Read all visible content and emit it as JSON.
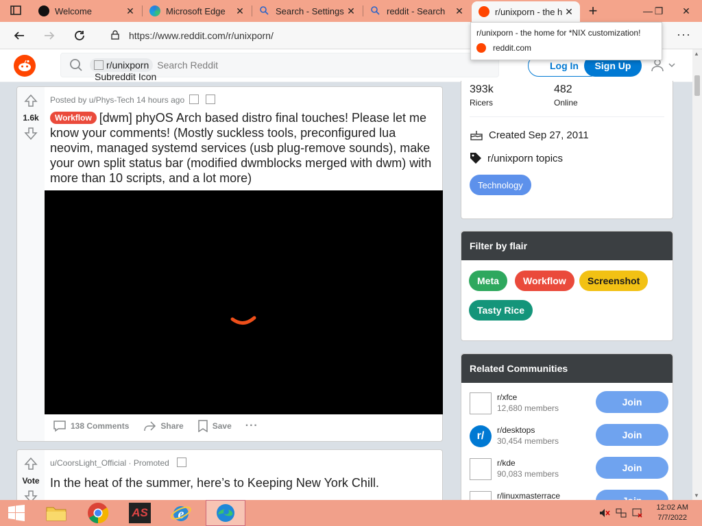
{
  "browser": {
    "tabs": [
      {
        "title": "Welcome",
        "close": "✕"
      },
      {
        "title": "Microsoft Edge",
        "close": "✕"
      },
      {
        "title": "Search - Settings",
        "close": "✕"
      },
      {
        "title": "reddit - Search",
        "close": "✕"
      },
      {
        "title": "r/unixporn - the h",
        "close": "✕",
        "active": true
      }
    ],
    "url": "https://www.reddit.com/r/unixporn/",
    "tooltip": {
      "title": "r/unixporn - the home for *NIX customization!",
      "domain": "reddit.com"
    }
  },
  "header": {
    "sub_chip": "r/unixporn",
    "sub_icon_alt": "Subreddit Icon",
    "search_placeholder": "Search Reddit",
    "login": "Log In",
    "signup": "Sign Up"
  },
  "post1": {
    "score": "1.6k",
    "meta": "Posted by u/Phys-Tech 14 hours ago",
    "flair": "Workflow",
    "title": "[dwm] phyOS Arch based distro final touches! Please let me know your comments! (Mostly suckless tools, preconfigured lua neovim, managed systemd services (usb plug-remove sounds), make your own split status bar (modified dwmblocks merged with dwm) with more than 10 scripts, and a lot more)",
    "comments": "138 Comments",
    "share": "Share",
    "save": "Save"
  },
  "post2": {
    "vote": "Vote",
    "meta": "u/CoorsLight_Official · Promoted",
    "title": "In the heat of the summer, here’s to Keeping New York Chill."
  },
  "about": {
    "members": "393k",
    "members_label": "Ricers",
    "online": "482",
    "online_label": "Online",
    "created": "Created Sep 27, 2011",
    "topics_label": "r/unixporn topics",
    "topic": "Technology"
  },
  "flair_widget": {
    "title": "Filter by flair",
    "flairs": [
      {
        "label": "Meta",
        "color": "#2ea85e",
        "text": "#ffffff"
      },
      {
        "label": "Workflow",
        "color": "#ea4a3b",
        "text": "#ffffff"
      },
      {
        "label": "Screenshot",
        "color": "#f2c114",
        "text": "#1c1c1c"
      },
      {
        "label": "Tasty Rice",
        "color": "#14957a",
        "text": "#ffffff"
      }
    ]
  },
  "related": {
    "title": "Related Communities",
    "join": "Join",
    "items": [
      {
        "name": "r/xfce",
        "members": "12,680 members"
      },
      {
        "name": "r/desktops",
        "members": "30,454 members"
      },
      {
        "name": "r/kde",
        "members": "90,083 members"
      },
      {
        "name": "r/linuxmasterrace",
        "members": ""
      }
    ]
  },
  "taskbar": {
    "time": "12:02 AM",
    "date": "7/7/2022"
  },
  "colors": {
    "accent": "#0079d3",
    "reddit": "#ff4500",
    "tabstrip": "#f4a48b"
  }
}
